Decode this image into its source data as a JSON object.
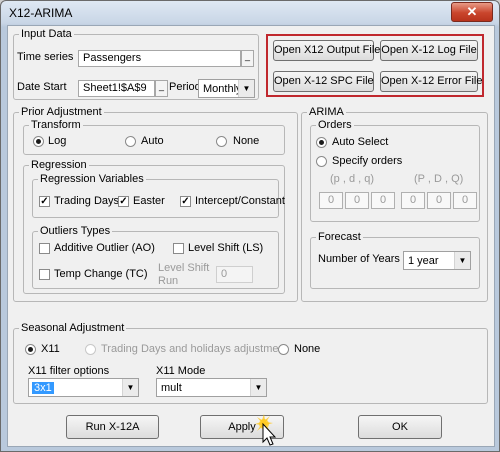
{
  "window": {
    "title": "X12-ARIMA",
    "close_glyph": "✕"
  },
  "input_data": {
    "legend": "Input Data",
    "time_series_label": "Time series",
    "time_series_value": "Passengers",
    "date_start_label": "Date Start",
    "date_start_value": "Sheet1!$A$9",
    "period_label": "Period",
    "period_value": "Monthly",
    "ref_button_glyph": "_"
  },
  "file_buttons": {
    "open_output": "Open X12 Output File",
    "open_log": "Open X-12 Log File",
    "open_spc": "Open X-12 SPC File",
    "open_error": "Open X-12 Error File"
  },
  "prior_adjustment": {
    "legend": "Prior Adjustment",
    "transform": {
      "legend": "Transform",
      "options": [
        "Log",
        "Auto",
        "None"
      ],
      "selected": "Log"
    },
    "regression": {
      "legend": "Regression",
      "variables": {
        "legend": "Regression Variables",
        "trading_days": {
          "label": "Trading Days",
          "checked": true
        },
        "easter": {
          "label": "Easter",
          "checked": true
        },
        "intercept": {
          "label": "Intercept/Constant",
          "checked": true
        }
      },
      "outliers": {
        "legend": "Outliers Types",
        "additive": {
          "label": "Additive Outlier (AO)",
          "checked": false
        },
        "level_shift": {
          "label": "Level Shift (LS)",
          "checked": false
        },
        "temp_change": {
          "label": "Temp Change (TC)",
          "checked": false
        },
        "level_shift_run_label_1": "Level Shift",
        "level_shift_run_label_2": "Run",
        "level_shift_run_value": "0"
      }
    }
  },
  "arima": {
    "legend": "ARIMA",
    "orders": {
      "legend": "Orders",
      "auto_select": "Auto Select",
      "specify_orders": "Specify orders",
      "selected": "Auto Select",
      "header_nonseasonal": "(p , d , q)",
      "header_seasonal": "(P , D , Q)",
      "values": [
        "0",
        "0",
        "0",
        "0",
        "0",
        "0"
      ]
    },
    "forecast": {
      "legend": "Forecast",
      "years_label": "Number of Years",
      "years_value": "1 year"
    }
  },
  "seasonal_adjustment": {
    "legend": "Seasonal Adjustment",
    "options": [
      "X11",
      "Trading Days and holidays adjustment",
      "None"
    ],
    "selected": "X11",
    "filter_label": "X11 filter options",
    "filter_value": "3x1",
    "mode_label": "X11 Mode",
    "mode_value": "mult"
  },
  "actions": {
    "run": "Run X-12A",
    "apply": "Apply",
    "ok": "OK"
  },
  "icons": {
    "dropdown_arrow": "▼",
    "check_mark": "✓"
  },
  "colors": {
    "highlight_frame": "#c0282e",
    "selection": "#3399ff",
    "close_button": "#c9452c"
  }
}
